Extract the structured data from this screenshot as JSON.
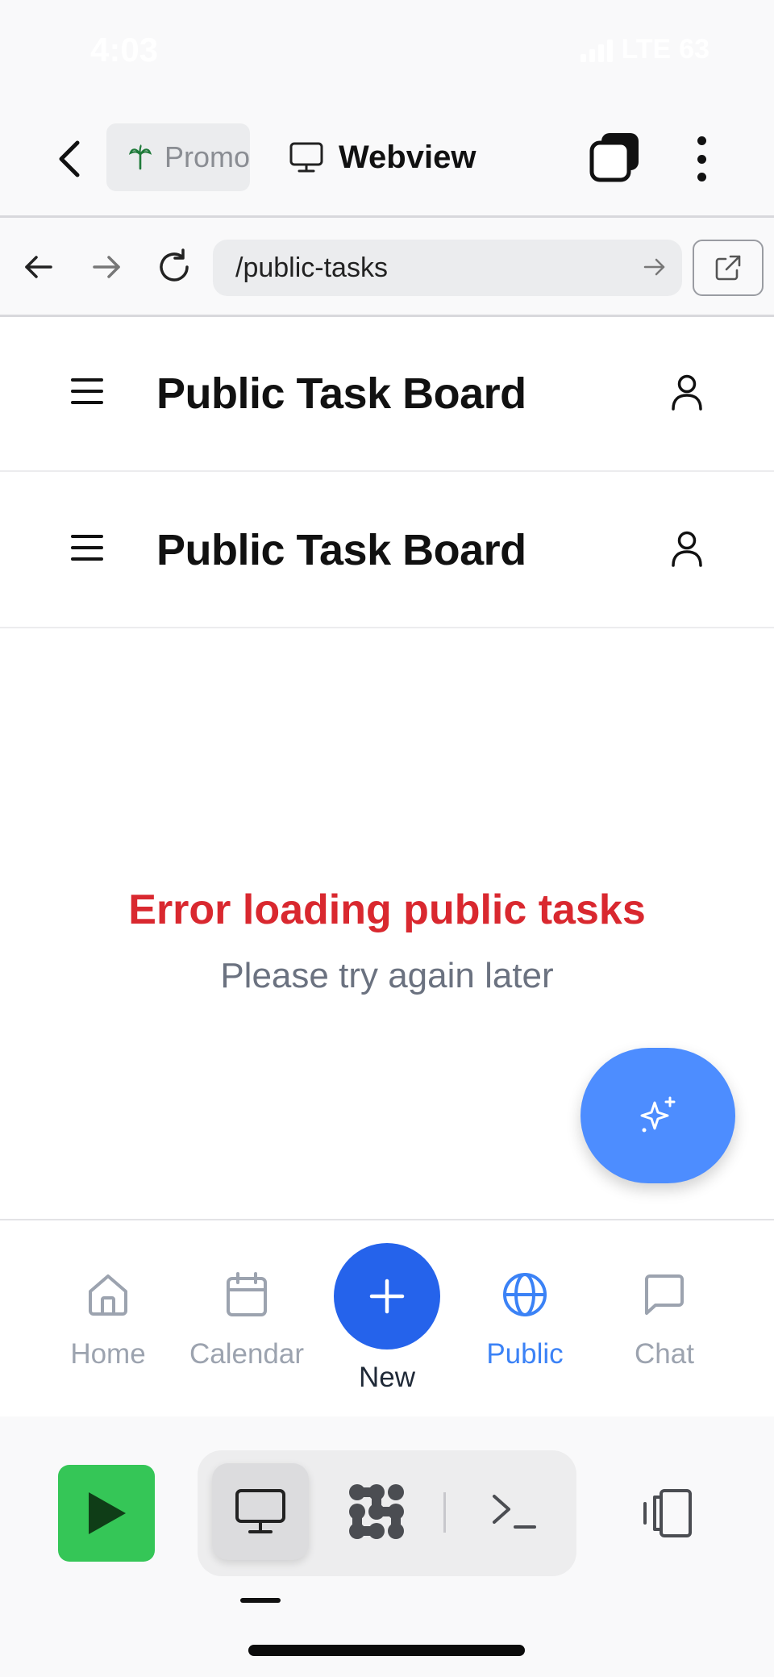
{
  "status_bar": {
    "time": "4:03",
    "network": "LTE",
    "battery": "63"
  },
  "toolbar": {
    "back_label": "Back",
    "tabs": [
      {
        "label": "Promo",
        "icon": "palm-tree-icon"
      },
      {
        "label": "Webview",
        "icon": "monitor-icon"
      }
    ]
  },
  "url_bar": {
    "value": "/public-tasks"
  },
  "app": {
    "headers": [
      {
        "title": "Public Task Board"
      },
      {
        "title": "Public Task Board"
      }
    ],
    "error": {
      "title": "Error loading public tasks",
      "subtitle": "Please try again later"
    }
  },
  "bottom_nav": {
    "items": [
      {
        "label": "Home",
        "icon": "home-icon"
      },
      {
        "label": "Calendar",
        "icon": "calendar-icon"
      },
      {
        "label": "New",
        "icon": "plus-icon"
      },
      {
        "label": "Public",
        "icon": "globe-icon",
        "active": true
      },
      {
        "label": "Chat",
        "icon": "chat-icon"
      }
    ]
  },
  "colors": {
    "accent": "#2563eb",
    "active_nav": "#3b82f6",
    "error": "#d9282f",
    "fab": "#4d8dff",
    "play": "#35c657"
  }
}
